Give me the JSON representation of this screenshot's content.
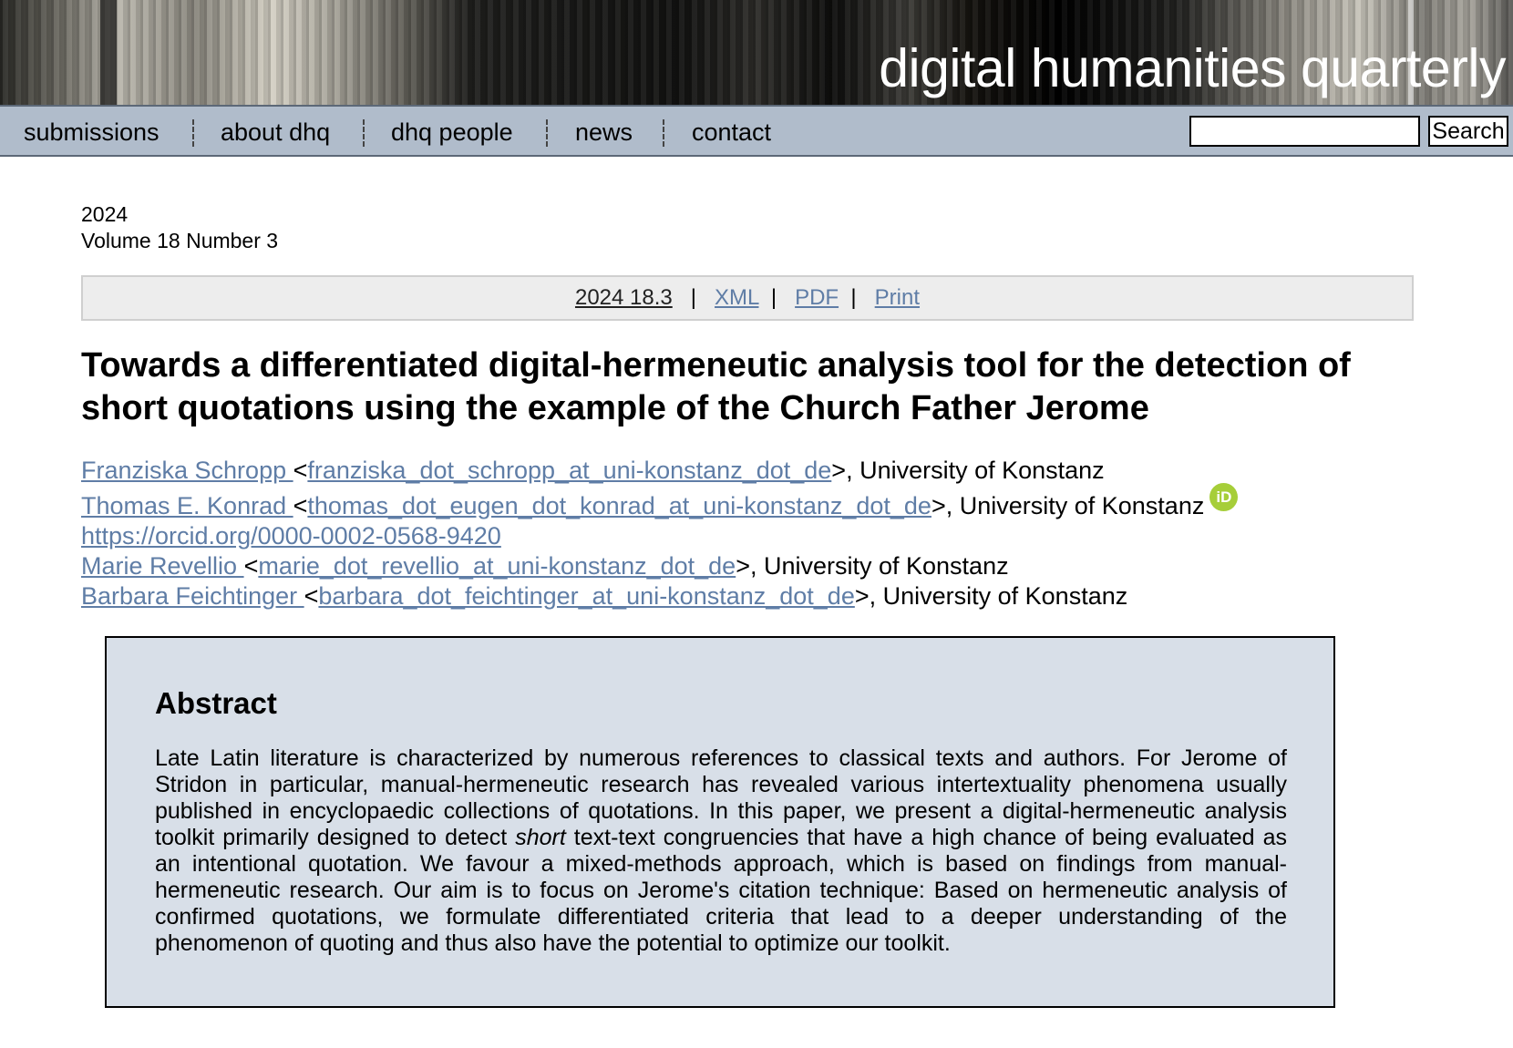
{
  "site": {
    "title": "digital humanities quarterly"
  },
  "nav": {
    "items": [
      "submissions",
      "about dhq",
      "dhq people",
      "news",
      "contact"
    ],
    "search": {
      "value": "",
      "button_label": "Search"
    }
  },
  "issue": {
    "year": "2024",
    "volume_line": "Volume 18 Number 3"
  },
  "toolbar": {
    "issue_link": "2024 18.3",
    "sep": "|",
    "xml": "XML",
    "pdf": "PDF",
    "print": "Print"
  },
  "article": {
    "title": "Towards a differentiated digital-hermeneutic analysis tool for the detection of short quotations using the example of the Church Father Jerome",
    "authors": [
      {
        "name": "Franziska Schropp ",
        "email": "franziska_dot_schropp_at_uni-konstanz_dot_de",
        "affiliation": ">, University of Konstanz"
      },
      {
        "name": "Thomas E. Konrad ",
        "email": "thomas_dot_eugen_dot_konrad_at_uni-konstanz_dot_de",
        "affiliation": ">, University of Konstanz",
        "orcid": " https://orcid.org/0000-0002-0568-9420",
        "orcid_icon_label": "iD"
      },
      {
        "name": "Marie Revellio ",
        "email": "marie_dot_revellio_at_uni-konstanz_dot_de",
        "affiliation": ">, University of Konstanz"
      },
      {
        "name": "Barbara Feichtinger ",
        "email": "barbara_dot_feichtinger_at_uni-konstanz_dot_de",
        "affiliation": ">, University of Konstanz"
      }
    ],
    "email_open": " <"
  },
  "abstract": {
    "heading": "Abstract",
    "text_before": "Late Latin literature is characterized by numerous references to classical texts and authors. For Jerome of Stridon in particular, manual-hermeneutic research has revealed various intertextuality phenomena usually published in encyclopaedic collections of quotations. In this paper, we present a digital-hermeneutic analysis toolkit primarily designed to detect ",
    "text_emphasis": "short",
    "text_after": " text-text congruencies that have a high chance of being evaluated as an intentional quotation. We favour a mixed-methods approach, which is based on findings from manual-hermeneutic research. Our aim is to focus on Jerome's citation technique: Based on hermeneutic analysis of confirmed quotations, we formulate differentiated criteria that lead to a deeper understanding of the phenomenon of quoting and thus also have the potential to optimize our toolkit."
  }
}
